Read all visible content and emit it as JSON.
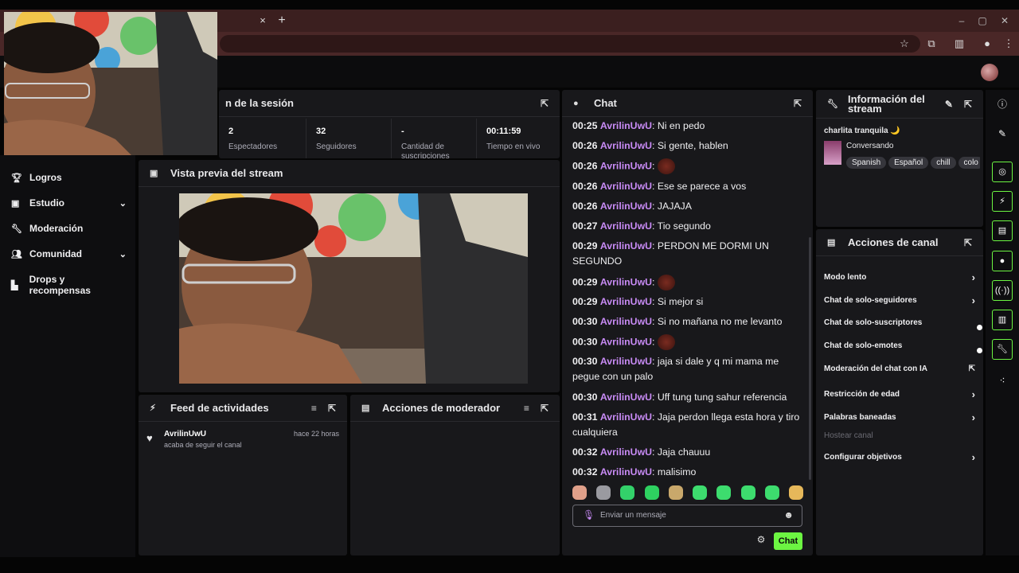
{
  "browser": {
    "tab_close": "×",
    "tab_new": "+",
    "win_min": "–",
    "win_max": "▢",
    "win_close": "✕"
  },
  "sidebar": {
    "items": [
      {
        "label": "Logros",
        "icon": "trophy-icon"
      },
      {
        "label": "Estudio",
        "icon": "studio-icon",
        "chevron": true
      },
      {
        "label": "Moderación",
        "icon": "wrench-icon"
      },
      {
        "label": "Comunidad",
        "icon": "community-icon",
        "chevron": true
      },
      {
        "label": "Drops y recompensas",
        "icon": "drops-icon"
      }
    ]
  },
  "session": {
    "title": "n de la sesión",
    "stats": [
      {
        "value": "2",
        "label": "Espectadores"
      },
      {
        "value": "32",
        "label": "Seguidores"
      },
      {
        "value": "-",
        "label": "Cantidad de suscripciones"
      },
      {
        "value": "00:11:59",
        "label": "Tiempo en vivo"
      }
    ]
  },
  "preview": {
    "title": "Vista previa del stream"
  },
  "feed": {
    "title": "Feed de actividades",
    "items": [
      {
        "user": "AvrilinUwU",
        "time": "hace 22 horas",
        "text": "acaba de seguir el canal"
      }
    ]
  },
  "mod_actions": {
    "title": "Acciones de moderador"
  },
  "chat": {
    "title": "Chat",
    "messages": [
      {
        "time": "00:25",
        "user": "AvrilinUwU",
        "text": "Ni en pedo"
      },
      {
        "time": "00:26",
        "user": "AvrilinUwU",
        "text": "Si gente, hablen"
      },
      {
        "time": "00:26",
        "user": "AvrilinUwU",
        "text": "",
        "emote": true
      },
      {
        "time": "00:26",
        "user": "AvrilinUwU",
        "text": "Ese se parece a vos"
      },
      {
        "time": "00:26",
        "user": "AvrilinUwU",
        "text": "JAJAJA"
      },
      {
        "time": "00:27",
        "user": "AvrilinUwU",
        "text": "Tio segundo"
      },
      {
        "time": "00:29",
        "user": "AvrilinUwU",
        "text": "PERDON ME DORMI UN SEGUNDO"
      },
      {
        "time": "00:29",
        "user": "AvrilinUwU",
        "text": "",
        "emote": true
      },
      {
        "time": "00:29",
        "user": "AvrilinUwU",
        "text": "Si mejor si"
      },
      {
        "time": "00:30",
        "user": "AvrilinUwU",
        "text": "Si no mañana no me levanto"
      },
      {
        "time": "00:30",
        "user": "AvrilinUwU",
        "text": "",
        "emote": true
      },
      {
        "time": "00:30",
        "user": "AvrilinUwU",
        "text": "jaja si dale y q mi mama me pegue con un palo"
      },
      {
        "time": "00:30",
        "user": "AvrilinUwU",
        "text": "Uff tung tung sahur referencia"
      },
      {
        "time": "00:31",
        "user": "AvrilinUwU",
        "text": "Jaja perdon llega esta hora y tiro cualquiera"
      },
      {
        "time": "00:32",
        "user": "AvrilinUwU",
        "text": "Jaja chauuu"
      },
      {
        "time": "00:32",
        "user": "AvrilinUwU",
        "text": "malisimo"
      }
    ],
    "input_placeholder": "Enviar un mensaje",
    "send_label": "Chat",
    "emote_colors": [
      "#e0a08a",
      "#9a9aa0",
      "#33d16a",
      "#2ed160",
      "#c9a86b",
      "#3ddc6e",
      "#3ddc6e",
      "#3ddc6e",
      "#3ddc6e",
      "#e6b85a"
    ]
  },
  "info": {
    "title": "Información del stream",
    "stream_title": "charlita tranquila 🌙",
    "category": "Conversando",
    "tags": [
      "Spanish",
      "Español",
      "chill",
      "colo"
    ]
  },
  "channel_actions": {
    "title": "Acciones de canal",
    "rows": [
      {
        "label": "Modo lento",
        "control": "chevron"
      },
      {
        "label": "Chat de solo-seguidores",
        "control": "chevron"
      },
      {
        "label": "Chat de solo-suscriptores",
        "control": "toggle"
      },
      {
        "label": "Chat de solo-emotes",
        "control": "toggle"
      },
      {
        "label": "Moderación del chat con IA",
        "control": "external"
      },
      {
        "label": "Restricción de edad",
        "control": "chevron"
      },
      {
        "label": "Palabras baneadas",
        "control": "chevron"
      },
      {
        "label": "Hostear canal",
        "control": "none",
        "disabled": true
      },
      {
        "label": "Configurar objetivos",
        "control": "chevron"
      }
    ]
  },
  "colors": {
    "accent": "#6cf542",
    "username": "#c88bf5",
    "panel": "#18181b"
  }
}
